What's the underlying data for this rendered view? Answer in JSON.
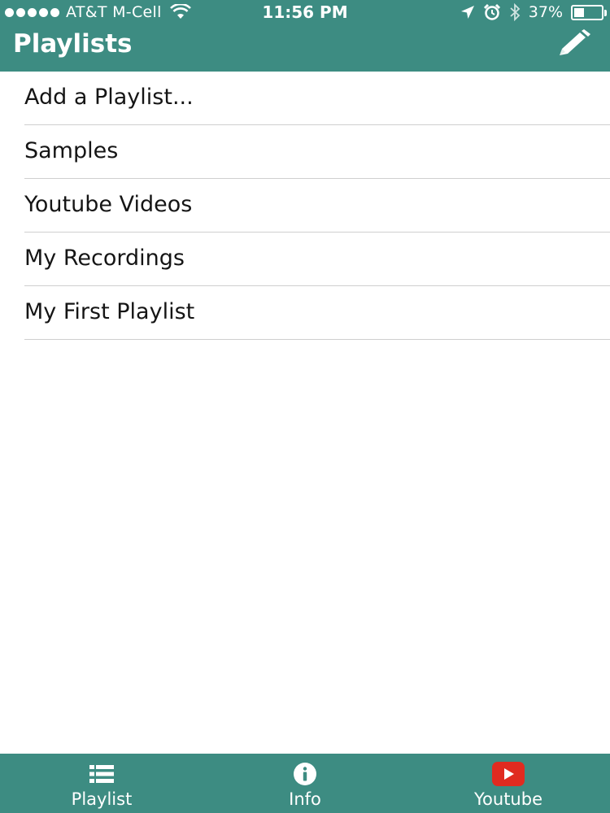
{
  "status_bar": {
    "carrier": "AT&T M-Cell",
    "time": "11:56 PM",
    "battery_percent_label": "37%",
    "battery_level": 0.37
  },
  "nav": {
    "title": "Playlists",
    "edit_icon": "pencil-icon"
  },
  "playlists": [
    {
      "label": "Add a Playlist..."
    },
    {
      "label": "Samples"
    },
    {
      "label": "Youtube Videos"
    },
    {
      "label": "My Recordings"
    },
    {
      "label": "My First Playlist"
    }
  ],
  "tabbar": {
    "tabs": [
      {
        "label": "Playlist",
        "icon": "list-icon"
      },
      {
        "label": "Info",
        "icon": "info-icon"
      },
      {
        "label": "Youtube",
        "icon": "youtube-icon"
      }
    ]
  },
  "colors": {
    "accent": "#3d8c82",
    "youtube_red": "#e02b20"
  }
}
